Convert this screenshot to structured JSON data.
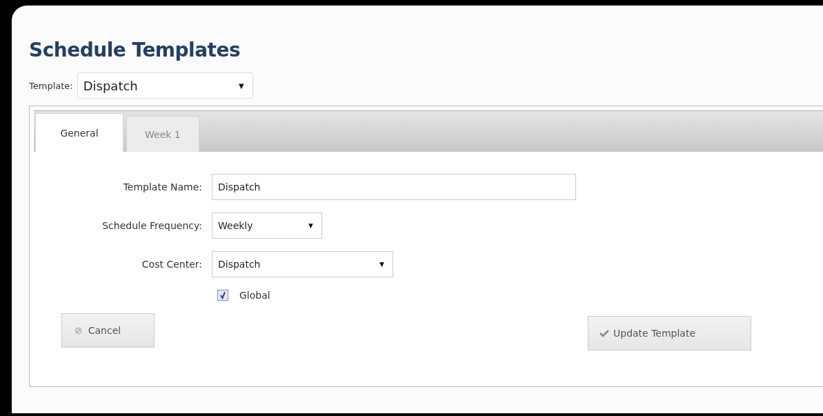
{
  "title": "Schedule Templates",
  "template_picker": {
    "label": "Template:",
    "value": "Dispatch",
    "arrow": "▼"
  },
  "tabs": [
    {
      "label": "General",
      "selected": true
    },
    {
      "label": "Week 1",
      "selected": false
    }
  ],
  "form": [
    {
      "kind": "text",
      "label": "Template Name:",
      "value": "Dispatch"
    },
    {
      "kind": "select",
      "label": "Schedule Frequency:",
      "value": "Weekly",
      "arrow": "▼"
    },
    {
      "kind": "select",
      "label": "Cost Center:",
      "value": "Dispatch",
      "arrow": "▼"
    },
    {
      "kind": "checkbox",
      "label": "Global",
      "checked": true
    }
  ],
  "buttons": [
    {
      "kind": "cancel",
      "label": "Cancel",
      "icon": "⊘"
    },
    {
      "kind": "confirm",
      "label": "Update Template"
    }
  ]
}
